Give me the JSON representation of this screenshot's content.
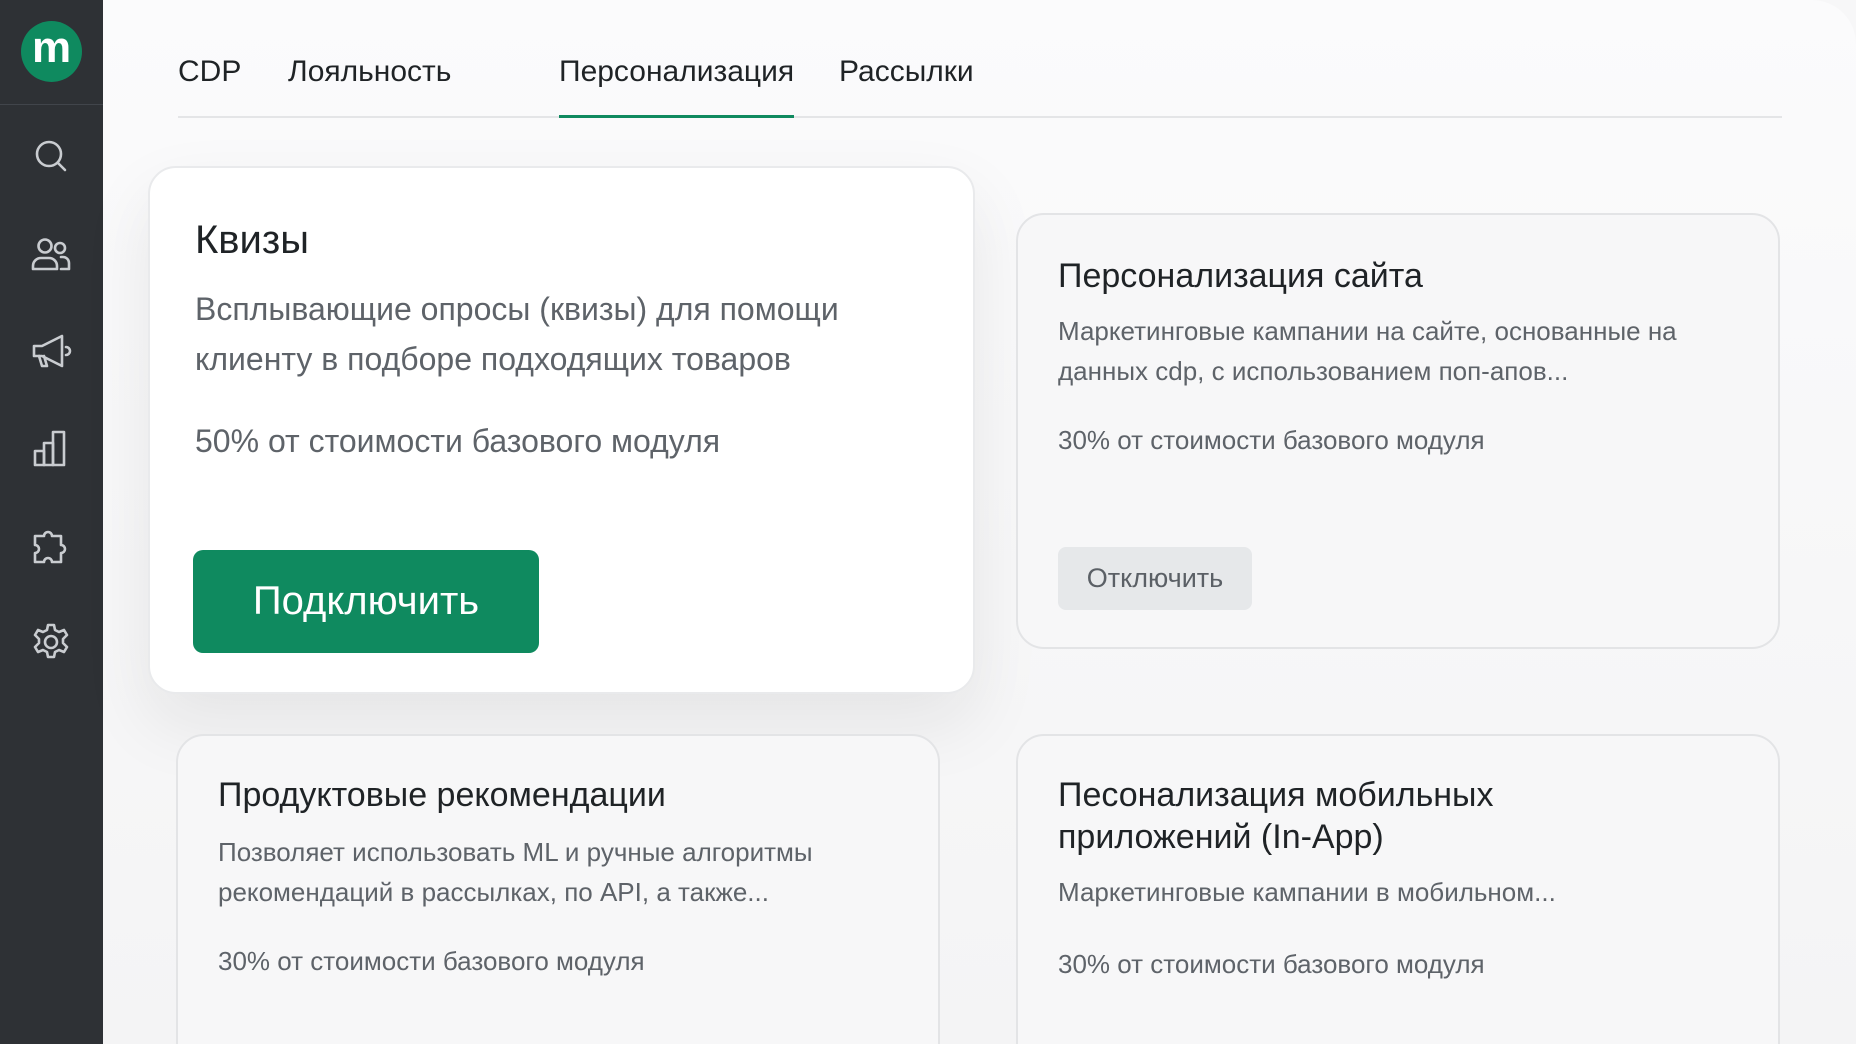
{
  "sidebar": {
    "logo_letter": "m",
    "icons": [
      "search-icon",
      "users-icon",
      "megaphone-icon",
      "analytics-icon",
      "puzzle-icon",
      "settings-icon"
    ]
  },
  "tabs": [
    {
      "label": "CDP",
      "active": false
    },
    {
      "label": "Лояльность",
      "active": false
    },
    {
      "label": "Персонализация",
      "active": true
    },
    {
      "label": "Рассылки",
      "active": false
    }
  ],
  "colors": {
    "accent": "#0f8a5f",
    "sidebar_bg": "#2e3135"
  },
  "cards": [
    {
      "title": "Квизы",
      "description": "Всплывающие опросы (квизы) для помощи клиенту в подборе подходящих товаров",
      "price": "50% от стоимости базового модуля",
      "action_label": "Подключить"
    },
    {
      "title": "Персонализация сайта",
      "description": "Маркетинговые кампании на сайте, основанные на данных cdp, с использованием поп-апов...",
      "price": "30% от стоимости базового модуля",
      "action_label": "Отключить"
    },
    {
      "title": "Продуктовые рекомендации",
      "description": "Позволяет использовать ML и ручные алгоритмы рекомендаций в рассылках, по API, а также...",
      "price": "30% от стоимости базового модуля"
    },
    {
      "title": "Песонализация мобильных приложений (In-App)",
      "description": "Маркетинговые кампании в мобильном...",
      "price": "30% от стоимости базового модуля"
    }
  ]
}
